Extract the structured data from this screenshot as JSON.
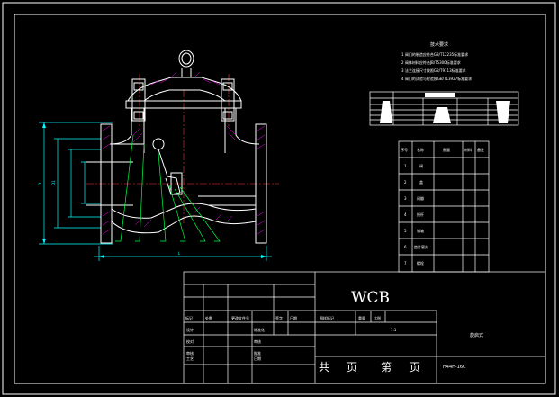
{
  "tech_requirements": {
    "title": "技术要求",
    "items": [
      "1 阀门的制造应符合GB/T12235标准要求",
      "2 阀体材料应符合JB/T5300标准要求",
      "3 法兰连接尺寸按照GB/T9113标准要求",
      "4 阀门的试验与检验按GB/T13927标准要求"
    ]
  },
  "params_table": {
    "title": "性能规范"
  },
  "parts_list": {
    "headers": [
      "序号",
      "名称",
      "数量",
      "材料",
      "备注"
    ],
    "rows": [
      {
        "no": "1",
        "name": "阀"
      },
      {
        "no": "2",
        "name": "盖"
      },
      {
        "no": "3",
        "name": "阀瓣"
      },
      {
        "no": "4",
        "name": "摇杆"
      },
      {
        "no": "5",
        "name": "销轴"
      },
      {
        "no": "6",
        "name": "垫片密封"
      },
      {
        "no": "7",
        "name": "螺栓"
      }
    ]
  },
  "title_block": {
    "material": "WCB",
    "header_cells": [
      "标记",
      "处数",
      "更改文件号",
      "签字",
      "日期"
    ],
    "header_cells2": [
      "图样标记",
      "重量",
      "比例"
    ],
    "rows": [
      {
        "role": "设计",
        "label": "标准化"
      },
      {
        "role": "校对",
        "label": "审核"
      },
      {
        "role": "审核",
        "label": "批准"
      },
      {
        "role": "工艺",
        "label": "日期"
      }
    ],
    "scale": "1:1",
    "drawing_name": "旋启式",
    "sheet_text": [
      "共",
      "页",
      "第",
      "页"
    ],
    "drawing_no": "H44H-16C"
  },
  "dimensions": {
    "bottom": "L",
    "left_outer": "D",
    "left_inner": "D1"
  },
  "colors": {
    "background": "#000000",
    "frame": "#ffffff",
    "part": "#ffffff",
    "dimension": "#00ffff",
    "leader": "#00ff00",
    "hatch": "#ff00ff",
    "centerline": "#ff0000"
  }
}
